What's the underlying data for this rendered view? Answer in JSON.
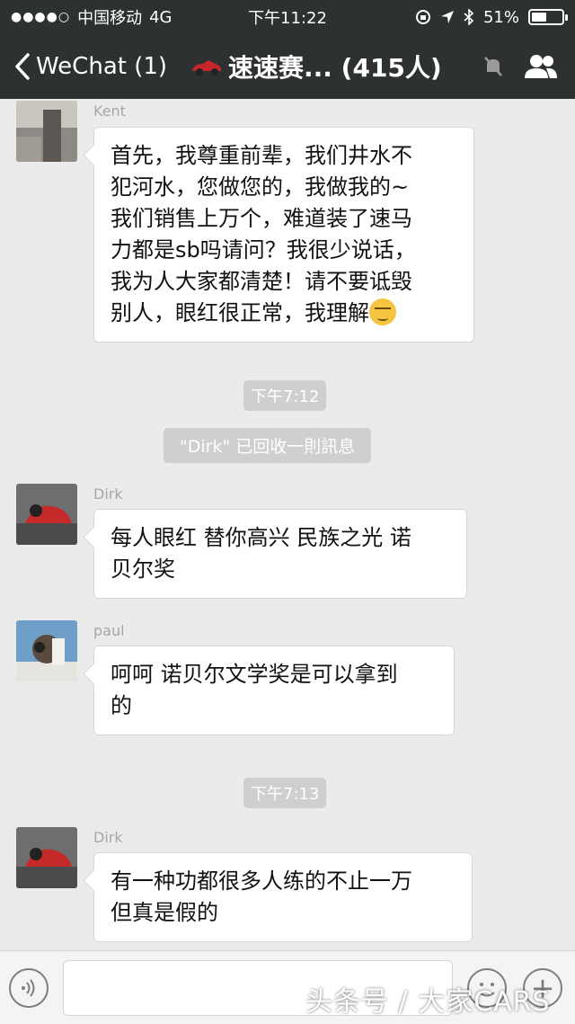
{
  "status_bar": {
    "carrier": "中国移动",
    "network": "4G",
    "time": "下午11:22",
    "battery": "51%",
    "battery_level": 0.51
  },
  "nav": {
    "back_label": "WeChat (1)",
    "title": "速速赛... (415人)"
  },
  "messages": [
    {
      "sender": "Kent",
      "text": "首先，我尊重前辈，我们井水不\n犯河水，您做您的，我做我的~\n我们销售上万个，难道装了速马\n力都是sb吗请问？我很少说话，\n我为人大家都清楚！请不要诋毁\n别人，眼红很正常，我理解"
    },
    {
      "time": "下午7:12"
    },
    {
      "system": "\"Dirk\" 已回收一則訊息"
    },
    {
      "sender": "Dirk",
      "text": "每人眼红 替你高兴 民族之光 诺\n贝尔奖"
    },
    {
      "sender": "paul",
      "text": "呵呵 诺贝尔文学奖是可以拿到\n的"
    },
    {
      "time": "下午7:13"
    },
    {
      "sender": "Dirk",
      "text": "有一种功都很多人练的不止一万\n但真是假的"
    }
  ],
  "watermark": "头条号 / 大家CARS",
  "colors": {
    "bar_bg": "#2e3132",
    "chat_bg": "#ebebeb",
    "bubble_bg": "#ffffff",
    "pill_bg": "#cfcfcf"
  }
}
